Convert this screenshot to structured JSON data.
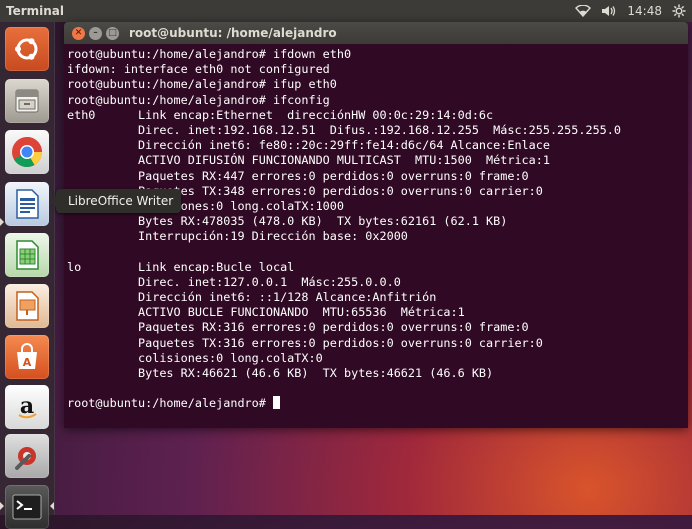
{
  "top_panel": {
    "app_title": "Terminal",
    "time": "14:48",
    "icons": [
      "wifi-icon",
      "volume-icon",
      "power-icon"
    ]
  },
  "launcher": {
    "items": [
      {
        "name": "ubuntu-dash",
        "icon": "ubuntu-logo-icon",
        "color": "#e05a2a"
      },
      {
        "name": "files",
        "icon": "file-cabinet-icon",
        "color": "#b9b4ac"
      },
      {
        "name": "chrome",
        "icon": "chrome-icon",
        "color": "#e5e5e5"
      },
      {
        "name": "libreoffice-writer",
        "icon": "writer-icon",
        "color": "#3a73b8"
      },
      {
        "name": "libreoffice-calc",
        "icon": "calc-icon",
        "color": "#3f9f3f"
      },
      {
        "name": "libreoffice-impress",
        "icon": "impress-icon",
        "color": "#d87626"
      },
      {
        "name": "software-center",
        "icon": "shopping-bag-icon",
        "color": "#e06030"
      },
      {
        "name": "amazon",
        "icon": "amazon-icon",
        "color": "#f2f2f2"
      },
      {
        "name": "system-settings",
        "icon": "settings-wrench-icon",
        "color": "#c33c2c"
      },
      {
        "name": "terminal",
        "icon": "terminal-icon",
        "color": "#3a3a3a"
      }
    ],
    "tooltip": "LibreOffice Writer"
  },
  "window": {
    "title": "root@ubuntu: /home/alejandro",
    "lines": [
      "root@ubuntu:/home/alejandro# ifdown eth0",
      "ifdown: interface eth0 not configured",
      "root@ubuntu:/home/alejandro# ifup eth0",
      "root@ubuntu:/home/alejandro# ifconfig",
      "eth0      Link encap:Ethernet  direcciónHW 00:0c:29:14:0d:6c",
      "          Direc. inet:192.168.12.51  Difus.:192.168.12.255  Másc:255.255.255.0",
      "          Dirección inet6: fe80::20c:29ff:fe14:d6c/64 Alcance:Enlace",
      "          ACTIVO DIFUSIÓN FUNCIONANDO MULTICAST  MTU:1500  Métrica:1",
      "          Paquetes RX:447 errores:0 perdidos:0 overruns:0 frame:0",
      "          Paquetes TX:348 errores:0 perdidos:0 overruns:0 carrier:0",
      "          colisiones:0 long.colaTX:1000",
      "          Bytes RX:478035 (478.0 KB)  TX bytes:62161 (62.1 KB)",
      "          Interrupción:19 Dirección base: 0x2000",
      "",
      "lo        Link encap:Bucle local",
      "          Direc. inet:127.0.0.1  Másc:255.0.0.0",
      "          Dirección inet6: ::1/128 Alcance:Anfitrión",
      "          ACTIVO BUCLE FUNCIONANDO  MTU:65536  Métrica:1",
      "          Paquetes RX:316 errores:0 perdidos:0 overruns:0 frame:0",
      "          Paquetes TX:316 errores:0 perdidos:0 overruns:0 carrier:0",
      "          colisiones:0 long.colaTX:0",
      "          Bytes RX:46621 (46.6 KB)  TX bytes:46621 (46.6 KB)",
      ""
    ],
    "prompt": "root@ubuntu:/home/alejandro# "
  }
}
